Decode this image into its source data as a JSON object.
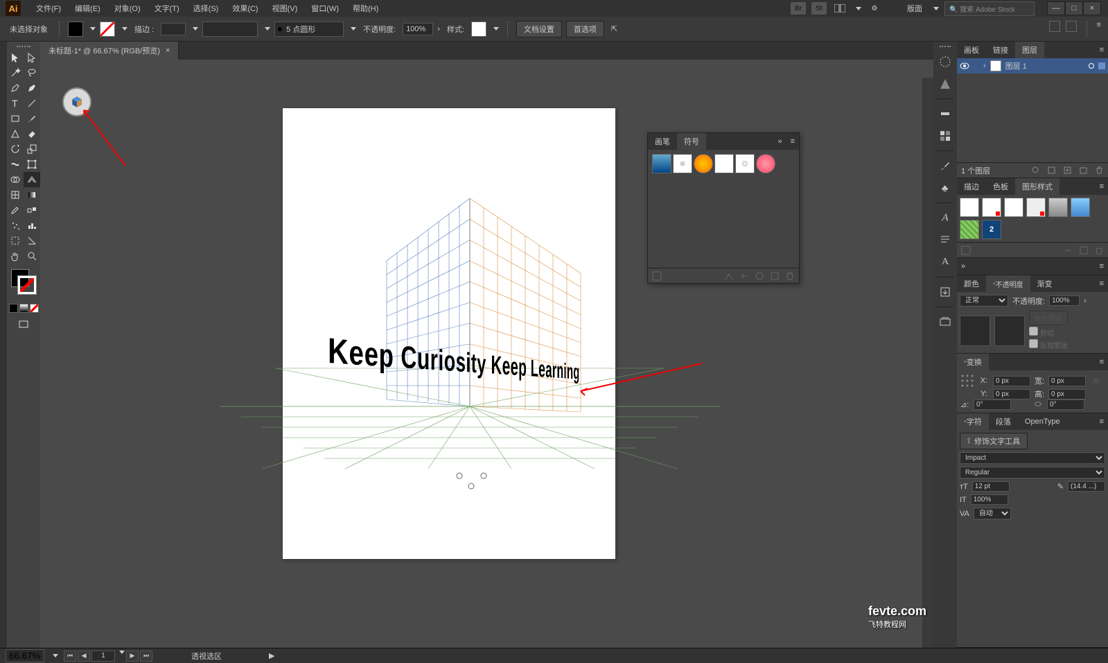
{
  "app": {
    "logo": "Ai"
  },
  "menu": {
    "file": "文件(F)",
    "edit": "编辑(E)",
    "object": "对象(O)",
    "type": "文字(T)",
    "select": "选择(S)",
    "effect": "效果(C)",
    "view": "视图(V)",
    "window": "窗口(W)",
    "help": "帮助(H)"
  },
  "menubar_right": {
    "layout_label": "版面",
    "search_placeholder": "搜索 Adobe Stock"
  },
  "control": {
    "no_selection": "未选择对象",
    "stroke_label": "描边 :",
    "brush_value": "5 点圆形",
    "opacity_label": "不透明度:",
    "opacity_value": "100%",
    "style_label": "样式:",
    "doc_setup": "文档设置",
    "prefs": "首选项"
  },
  "doc_tab": {
    "title": "未标题-1* @ 66.67% (RGB/预览)",
    "close": "×"
  },
  "canvas_text": "Keep Curiosity Keep Learning",
  "floating": {
    "tab_brushes": "画笔",
    "tab_symbols": "符号"
  },
  "layers_panel": {
    "tab_artboards": "画板",
    "tab_links": "链接",
    "tab_layers": "图层",
    "layer_name": "图层 1",
    "footer_count": "1 个图层"
  },
  "styles_panel": {
    "tab_stroke": "描边",
    "tab_swatches": "色板",
    "tab_gstyles": "图形样式"
  },
  "color_panel": {
    "tab_color": "颜色"
  },
  "transparency_panel": {
    "tab_color": "颜色",
    "tab_transparency": "不透明度",
    "tab_gradient": "渐变",
    "blend_mode": "正常",
    "opacity_label": "不透明度:",
    "opacity_value": "100%",
    "make_mask": "制作蒙版",
    "clip": "剪切",
    "invert": "反相蒙版"
  },
  "transform_panel": {
    "title": "变换",
    "x_label": "X:",
    "x_val": "0 px",
    "w_label": "宽:",
    "w_val": "0 px",
    "y_label": "Y:",
    "y_val": "0 px",
    "h_label": "高:",
    "h_val": "0 px",
    "angle_label": "⊿:",
    "angle_val": "0°",
    "h_angle": "0°"
  },
  "char_panel": {
    "tab_char": "字符",
    "tab_para": "段落",
    "tab_ot": "OpenType",
    "touch_type": "修饰文字工具",
    "font": "Impact",
    "style": "Regular",
    "size": "12 pt",
    "leading": "(14.4 ...)",
    "h_scale": "100%",
    "tracking": "自动"
  },
  "status": {
    "zoom": "66.67%",
    "page": "1",
    "tool": "透视选区"
  },
  "watermark": {
    "site": "fevte.com",
    "cn": "飞特教程网"
  }
}
